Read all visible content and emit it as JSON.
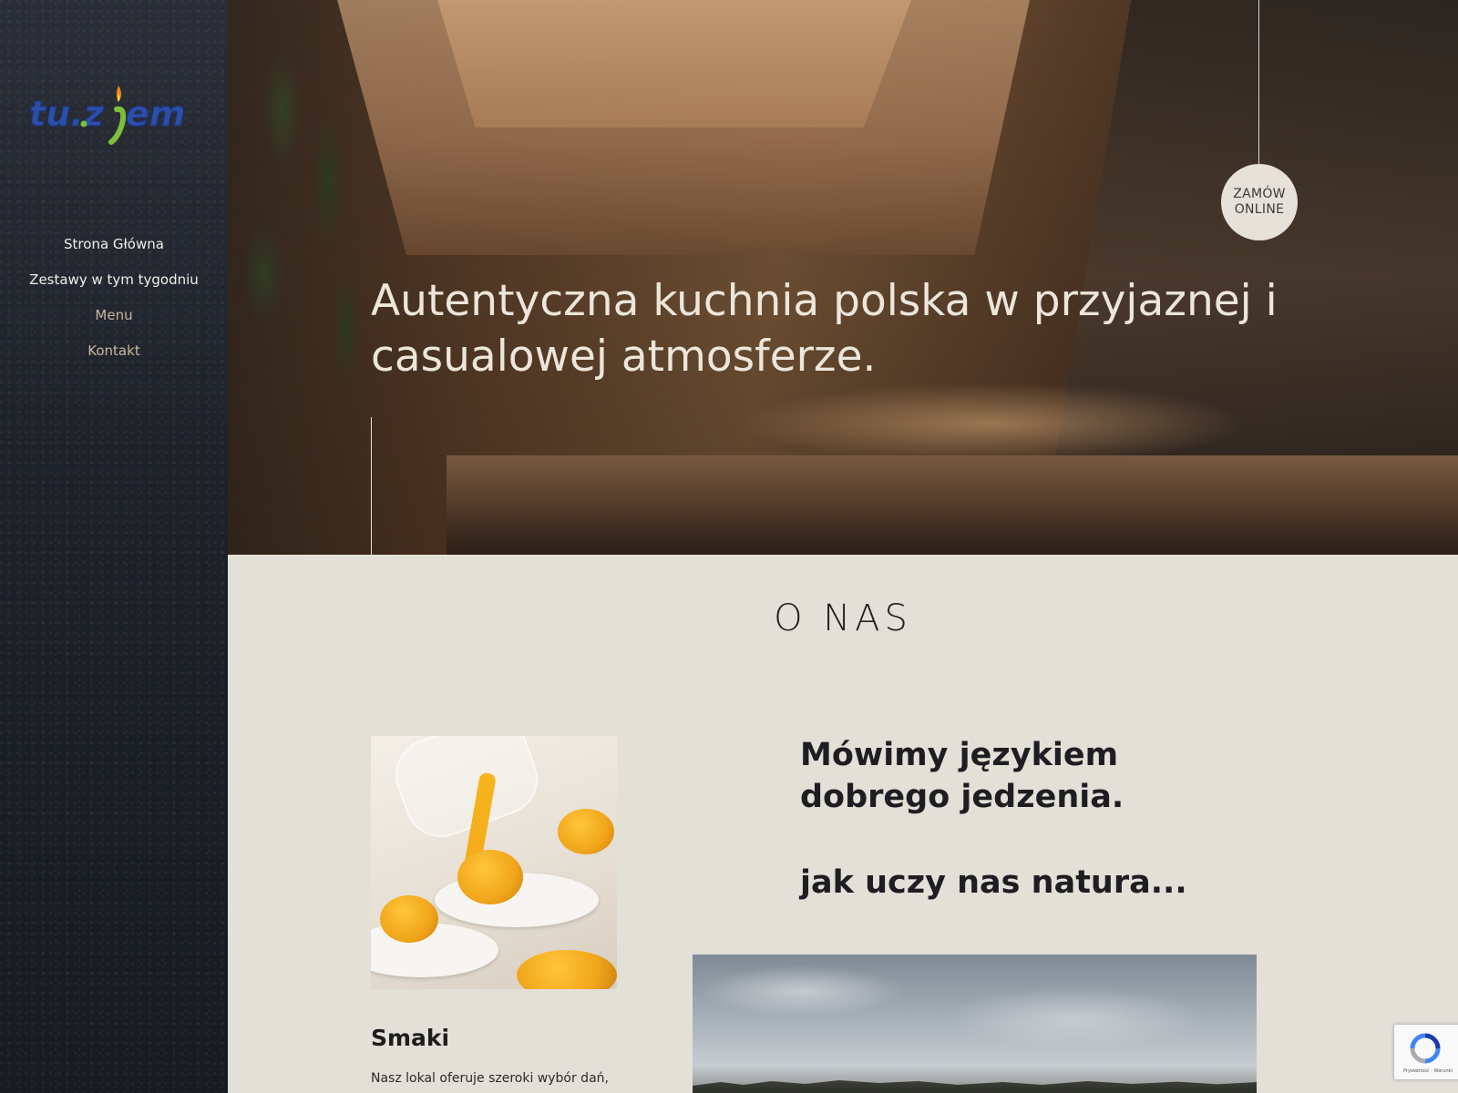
{
  "sidebar": {
    "logo_text": "tu.zjem",
    "nav": [
      {
        "label": "Strona Główna"
      },
      {
        "label": "Zestawy w tym tygodniu"
      },
      {
        "label": "Menu"
      },
      {
        "label": "Kontakt"
      }
    ]
  },
  "hero": {
    "title": "Autentyczna kuchnia polska w przyjaznej i casualowej atmosferze.",
    "order_button": {
      "line1": "ZAMÓW",
      "line2": "ONLINE"
    }
  },
  "about": {
    "heading": "O NAS",
    "tagline": "Mówimy językiem dobrego jedzenia.",
    "tagline2": "jak uczy nas natura...",
    "card": {
      "title": "Smaki",
      "text": "Nasz lokal oferuje szeroki wybór dań,"
    }
  },
  "recaptcha": {
    "footer": "Prywatność - Warunki"
  },
  "colors": {
    "sidebar_bg": "#1d2129",
    "page_bg": "#e3e0d8",
    "logo_blue": "#2b4fa8",
    "logo_green": "#7cbf3a",
    "heading_text": "#1e1e22",
    "nav_muted": "#c9b8a0"
  }
}
